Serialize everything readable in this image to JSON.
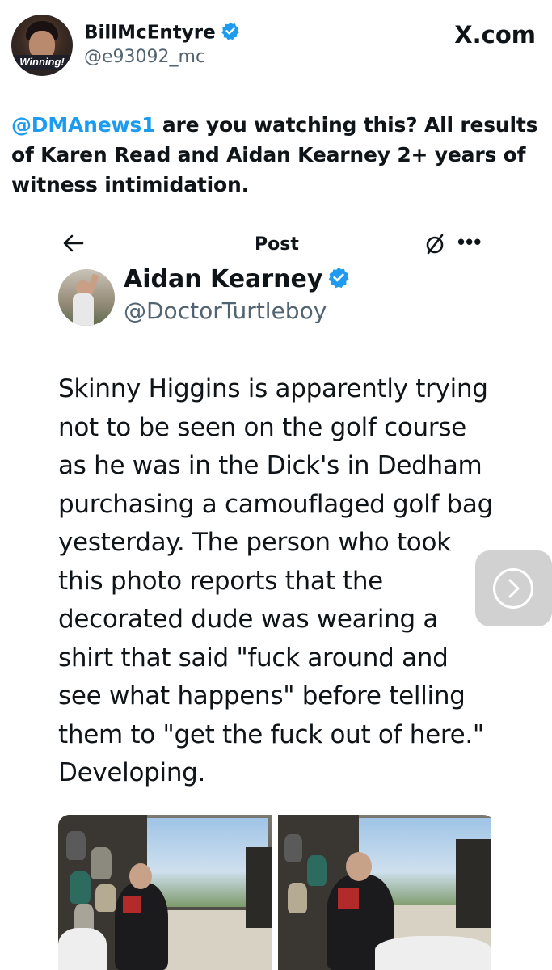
{
  "outer_post": {
    "avatar_caption": "Winning!",
    "name": "BillMcEntyre",
    "handle": "@e93092_mc",
    "site": "X.com",
    "mention": "@DMAnews1",
    "text": " are you watching this? All results of Karen Read and Aidan Kearney 2+ years of witness intimidation."
  },
  "inner_post": {
    "nav_title": "Post",
    "more_label": "•••",
    "name": "Aidan Kearney",
    "handle": "@DoctorTurtleboy",
    "text": "Skinny Higgins is apparently trying\nnot to be seen on the golf course\nas he was in the Dick's in Dedham\npurchasing a camouflaged golf bag\nyesterday. The person who took\nthis photo reports that the\ndecorated dude was wearing a\nshirt that said \"fuck around and\nsee what happens\" before telling\nthem to \"get the fuck out of here.\"\nDeveloping."
  },
  "colors": {
    "accent": "#1d9bf0",
    "text": "#0f1419",
    "secondary_text": "#536471"
  },
  "icons": [
    "verified-badge-icon",
    "back-arrow-icon",
    "slash-circle-icon",
    "more-icon",
    "chevron-right-icon"
  ]
}
